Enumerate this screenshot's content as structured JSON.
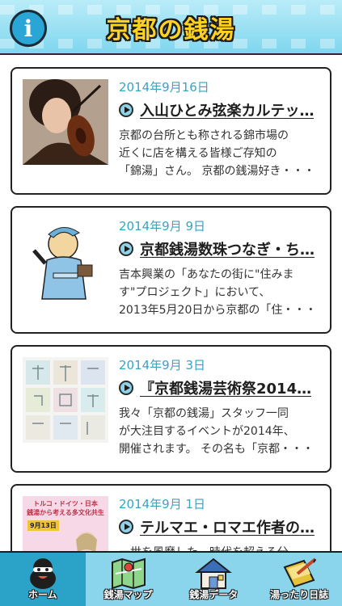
{
  "header": {
    "title": "京都の銭湯",
    "info_label": "i",
    "info_icon": "info-icon"
  },
  "colors": {
    "header_bg": "#8fd8ef",
    "title_fill": "#ffd21f",
    "date_color": "#3aa3c0",
    "tab_active": "#2ba3c9",
    "tab_bg": "#8ad4ec"
  },
  "articles": [
    {
      "date": "2014年9月16日",
      "title": "入山ひとみ弦楽カルテッ…",
      "excerpt": [
        "京都の台所とも称される錦市場の",
        "近くに店を構える皆様ご存知の",
        "「錦湯」さん。 京都の銭湯好き・・・"
      ],
      "thumb_icon": "violinist-photo"
    },
    {
      "date": "2014年9月 9日",
      "title": "京都銭湯数珠つなぎ・ち…",
      "excerpt": [
        "吉本興業の「あなたの街に\"住みま",
        "す\"プロジェクト」において、",
        "2013年5月20日から京都の「住・・・"
      ],
      "thumb_icon": "bather-illustration"
    },
    {
      "date": "2014年9月 3日",
      "title": "『京都銭湯芸術祭2014…",
      "excerpt": [
        "我々「京都の銭湯」スタッフ一同",
        "が大注目するイベントが2014年、",
        "開催されます。 その名も「京都・・・"
      ],
      "thumb_icon": "art-festival-poster"
    },
    {
      "date": "2014年9月 1日",
      "title": "テルマエ・ロマエ作者の…",
      "excerpt": [
        "一世を風靡した、時代を超える分"
      ],
      "thumb_icon": "event-flyer",
      "flyer_heading": [
        "トルコ・ドイツ・日本",
        "銭湯から考える多文化共生"
      ],
      "flyer_date": "9月13日"
    }
  ],
  "tabs": [
    {
      "label": "ホーム",
      "icon": "home-mascot-icon",
      "active": true
    },
    {
      "label": "銭湯マップ",
      "icon": "map-icon",
      "active": false
    },
    {
      "label": "銭湯データ",
      "icon": "bathhouse-icon",
      "active": false
    },
    {
      "label": "湯ったり日誌",
      "icon": "notebook-icon",
      "active": false
    }
  ]
}
